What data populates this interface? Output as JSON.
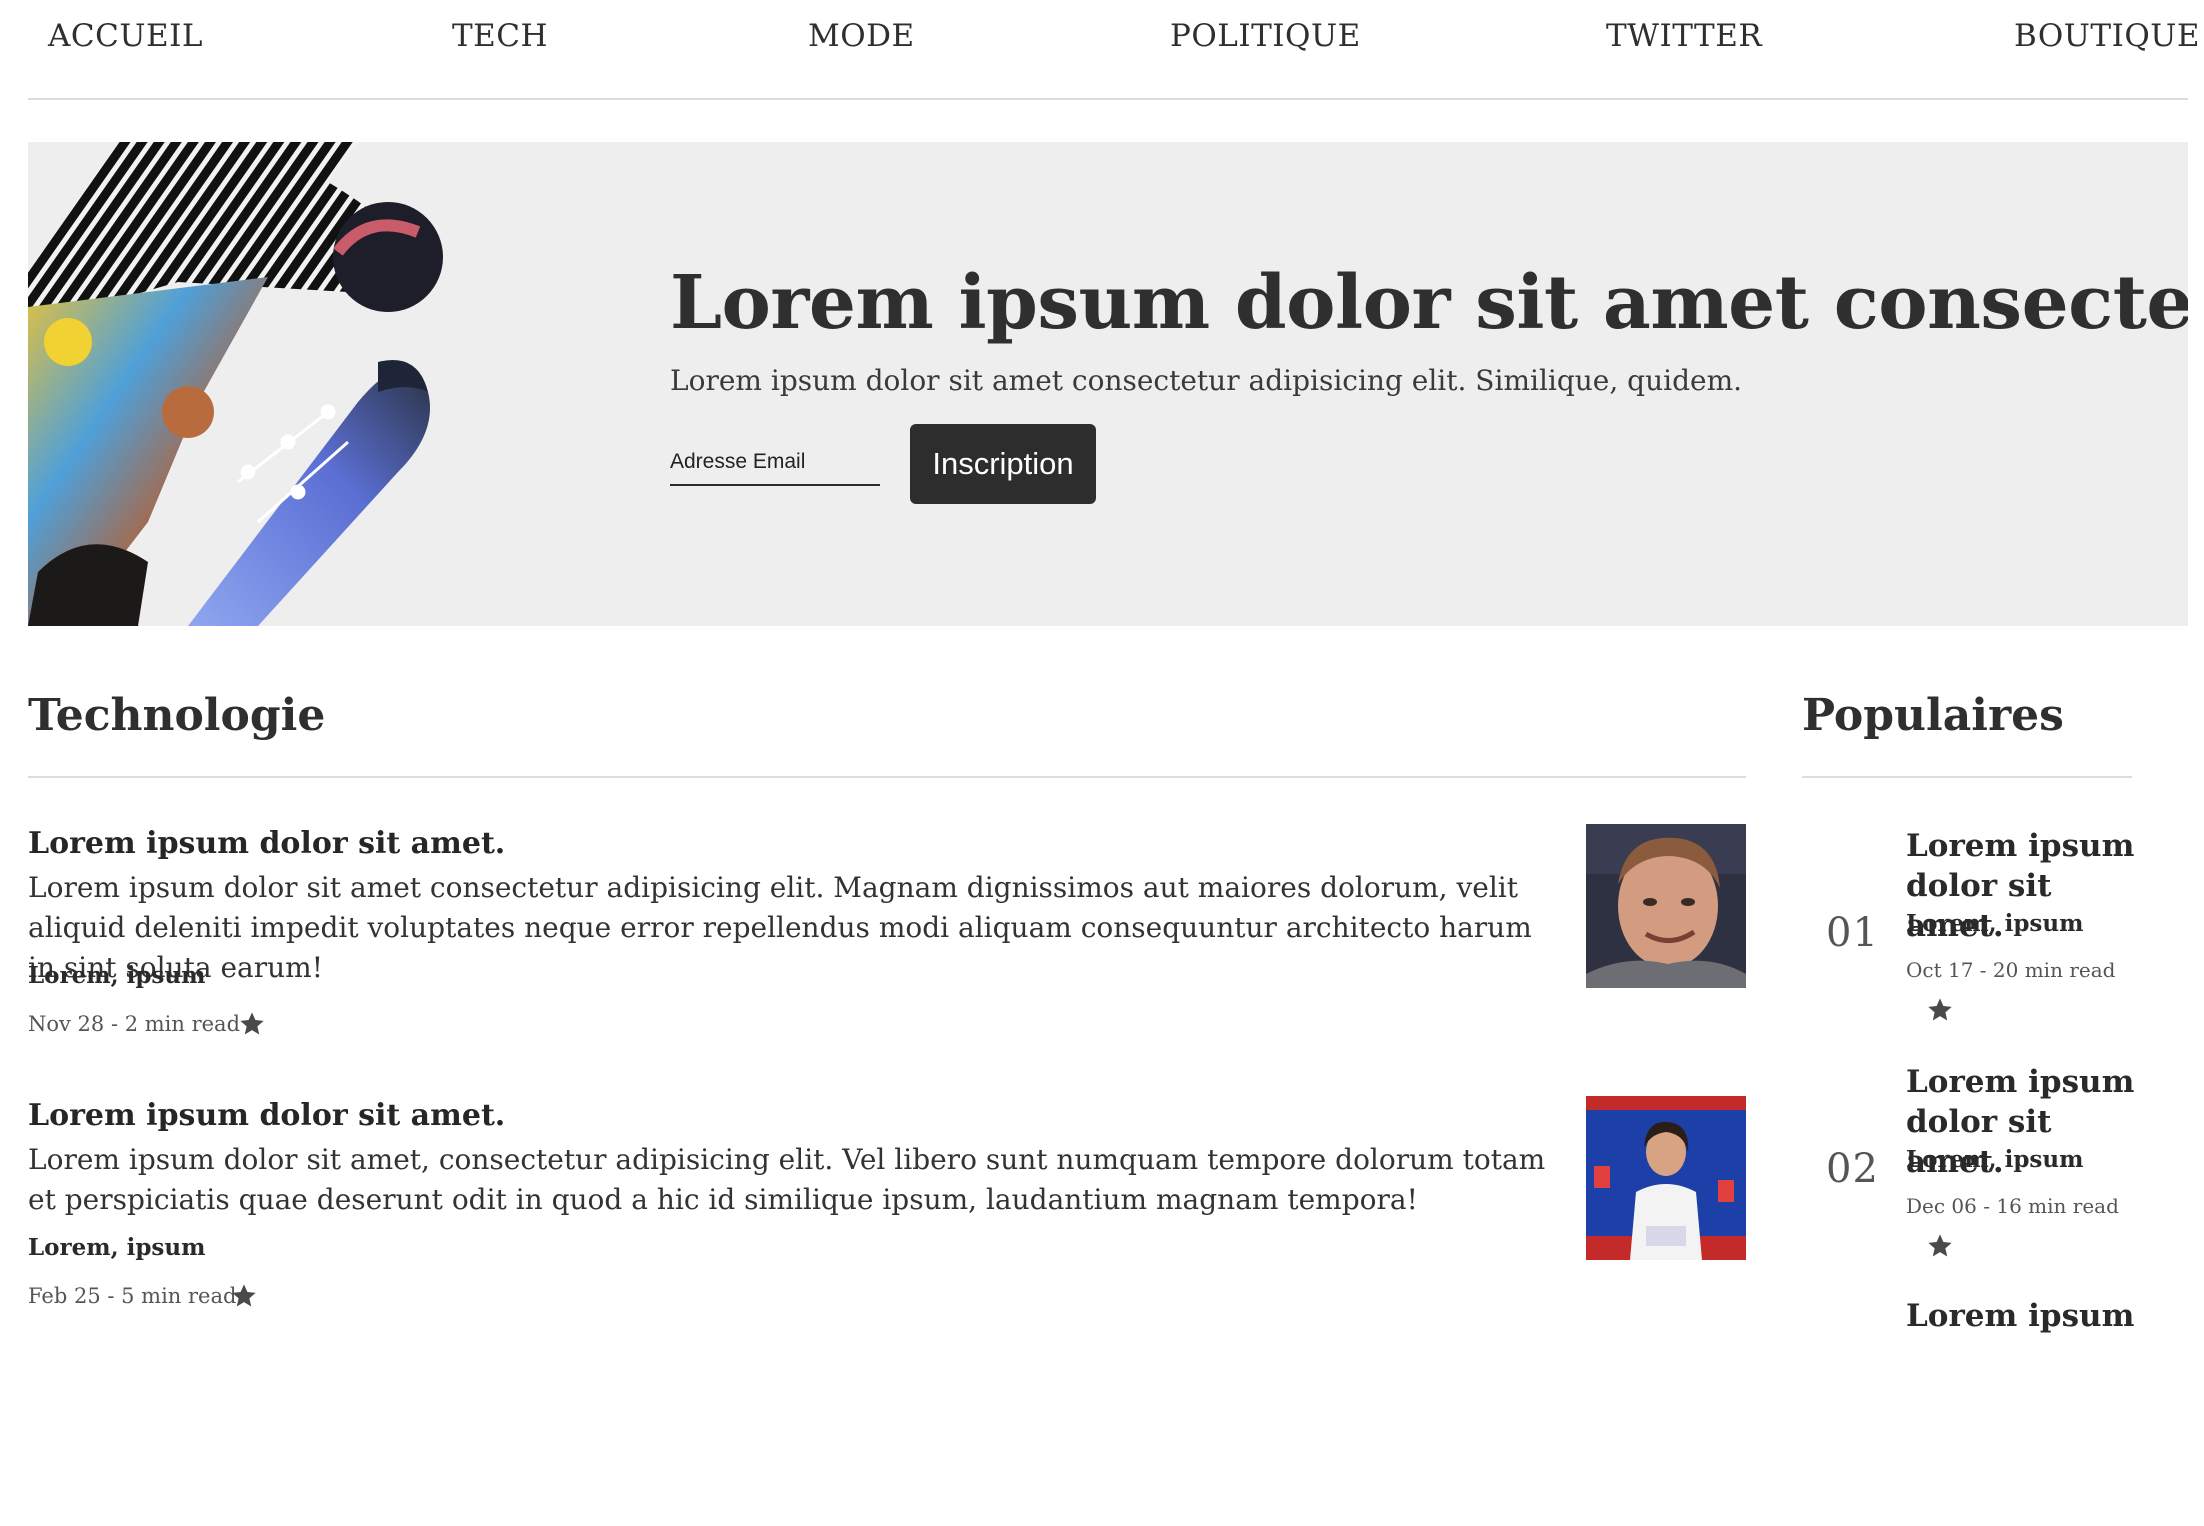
{
  "nav": {
    "items": [
      {
        "label": "ACCUEIL"
      },
      {
        "label": "TECH"
      },
      {
        "label": "MODE"
      },
      {
        "label": "POLITIQUE"
      },
      {
        "label": "TWITTER"
      },
      {
        "label": "BOUTIQUE"
      }
    ]
  },
  "hero": {
    "title": "Lorem ipsum dolor sit amet consectetur.",
    "subtitle": "Lorem ipsum dolor sit amet consectetur adipisicing elit. Similique, quidem.",
    "email_placeholder": "Adresse Email",
    "signup_label": "Inscription"
  },
  "technology": {
    "title": "Technologie",
    "articles": [
      {
        "title": "Lorem ipsum dolor sit amet.",
        "excerpt": "Lorem ipsum dolor sit amet consectetur adipisicing elit. Magnam dignissimos aut maiores dolorum, velit aliquid deleniti impedit voluptates neque error repellendus modi aliquam consequuntur architecto harum in sint soluta earum!",
        "author": "Lorem, ipsum",
        "meta": "Nov 28 - 2 min read"
      },
      {
        "title": "Lorem ipsum dolor sit amet.",
        "excerpt": "Lorem ipsum dolor sit amet, consectetur adipisicing elit. Vel libero sunt numquam tempore dolorum totam et perspiciatis quae deserunt odit in quod a hic id similique ipsum, laudantium magnam tempora!",
        "author": "Lorem, ipsum",
        "meta": "Feb 25 - 5 min read"
      }
    ]
  },
  "popular": {
    "title": "Populaires",
    "items": [
      {
        "rank": "01",
        "title": "Lorem ipsum dolor sit amet.",
        "author": "Lorem, ipsum",
        "meta": "Oct 17 - 20 min read"
      },
      {
        "rank": "02",
        "title": "Lorem ipsum dolor sit amet.",
        "author": "Lorem, ipsum",
        "meta": "Dec 06 - 16 min read"
      },
      {
        "title": "Lorem ipsum"
      }
    ]
  },
  "icons": {
    "bookmark": "star-icon"
  },
  "colors": {
    "hero_bg": "#eeeeee",
    "button_bg": "#2d2d2d",
    "text": "#2b2b2b"
  }
}
